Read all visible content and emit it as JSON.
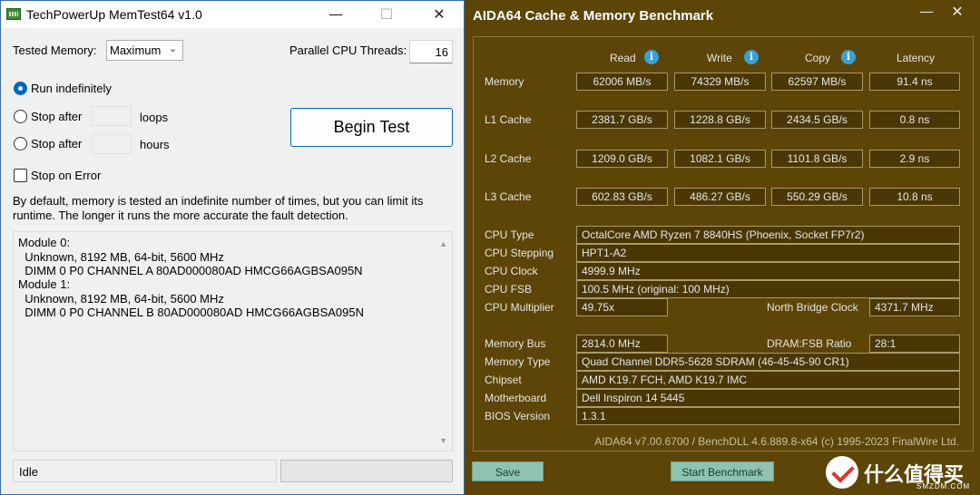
{
  "memtest": {
    "title": "TechPowerUp MemTest64 v1.0",
    "window_buttons": {
      "minimize": "—",
      "maximize": "☐",
      "close": "✕"
    },
    "tested_memory_label": "Tested Memory:",
    "tested_memory_value": "Maximum",
    "threads_label": "Parallel CPU Threads:",
    "threads_value": "16",
    "run_indefinitely": "Run indefinitely",
    "stop_after_1": "Stop after",
    "loops": "loops",
    "stop_after_2": "Stop after",
    "hours": "hours",
    "stop_on_error": "Stop on Error",
    "begin_test": "Begin Test",
    "description_1": "By default, memory is tested an indefinite number of times, but you can limit its",
    "description_2": "runtime. The longer it runs the more accurate the fault detection.",
    "output": [
      "Module 0:",
      "  Unknown, 8192 MB, 64-bit, 5600 MHz",
      "  DIMM 0 P0 CHANNEL A 80AD000080AD HMCG66AGBSA095N",
      "Module 1:",
      "  Unknown, 8192 MB, 64-bit, 5600 MHz",
      "  DIMM 0 P0 CHANNEL B 80AD000080AD HMCG66AGBSA095N"
    ],
    "status": "Idle"
  },
  "aida": {
    "title": "AIDA64 Cache & Memory Benchmark",
    "window_buttons": {
      "minimize": "—",
      "close": "✕"
    },
    "columns": {
      "read": "Read",
      "write": "Write",
      "copy": "Copy",
      "latency": "Latency"
    },
    "rows": {
      "memory": {
        "label": "Memory",
        "read": "62006 MB/s",
        "write": "74329 MB/s",
        "copy": "62597 MB/s",
        "latency": "91.4 ns"
      },
      "l1": {
        "label": "L1 Cache",
        "read": "2381.7 GB/s",
        "write": "1228.8 GB/s",
        "copy": "2434.5 GB/s",
        "latency": "0.8 ns"
      },
      "l2": {
        "label": "L2 Cache",
        "read": "1209.0 GB/s",
        "write": "1082.1 GB/s",
        "copy": "1101.8 GB/s",
        "latency": "2.9 ns"
      },
      "l3": {
        "label": "L3 Cache",
        "read": "602.83 GB/s",
        "write": "486.27 GB/s",
        "copy": "550.29 GB/s",
        "latency": "10.8 ns"
      }
    },
    "info": {
      "cpu_type_label": "CPU Type",
      "cpu_type": "OctalCore AMD Ryzen 7 8840HS  (Phoenix, Socket FP7r2)",
      "cpu_stepping_label": "CPU Stepping",
      "cpu_stepping": "HPT1-A2",
      "cpu_clock_label": "CPU Clock",
      "cpu_clock": "4999.9 MHz",
      "cpu_fsb_label": "CPU FSB",
      "cpu_fsb": "100.5 MHz  (original: 100 MHz)",
      "cpu_multiplier_label": "CPU Multiplier",
      "cpu_multiplier": "49.75x",
      "nb_clock_label": "North Bridge Clock",
      "nb_clock": "4371.7 MHz",
      "memory_bus_label": "Memory Bus",
      "memory_bus": "2814.0 MHz",
      "dram_ratio_label": "DRAM:FSB Ratio",
      "dram_ratio": "28:1",
      "memory_type_label": "Memory Type",
      "memory_type": "Quad Channel DDR5-5628 SDRAM  (46-45-45-90 CR1)",
      "chipset_label": "Chipset",
      "chipset": "AMD K19.7 FCH, AMD K19.7 IMC",
      "motherboard_label": "Motherboard",
      "motherboard": "Dell Inspiron 14 5445",
      "bios_label": "BIOS Version",
      "bios": "1.3.1"
    },
    "footer": "AIDA64 v7.00.6700 / BenchDLL 4.6.889.8-x64  (c) 1995-2023 FinalWire Ltd.",
    "save": "Save",
    "start_benchmark": "Start Benchmark"
  },
  "watermark": {
    "text": "什么值得买",
    "sub": "SMZDM.COM"
  }
}
